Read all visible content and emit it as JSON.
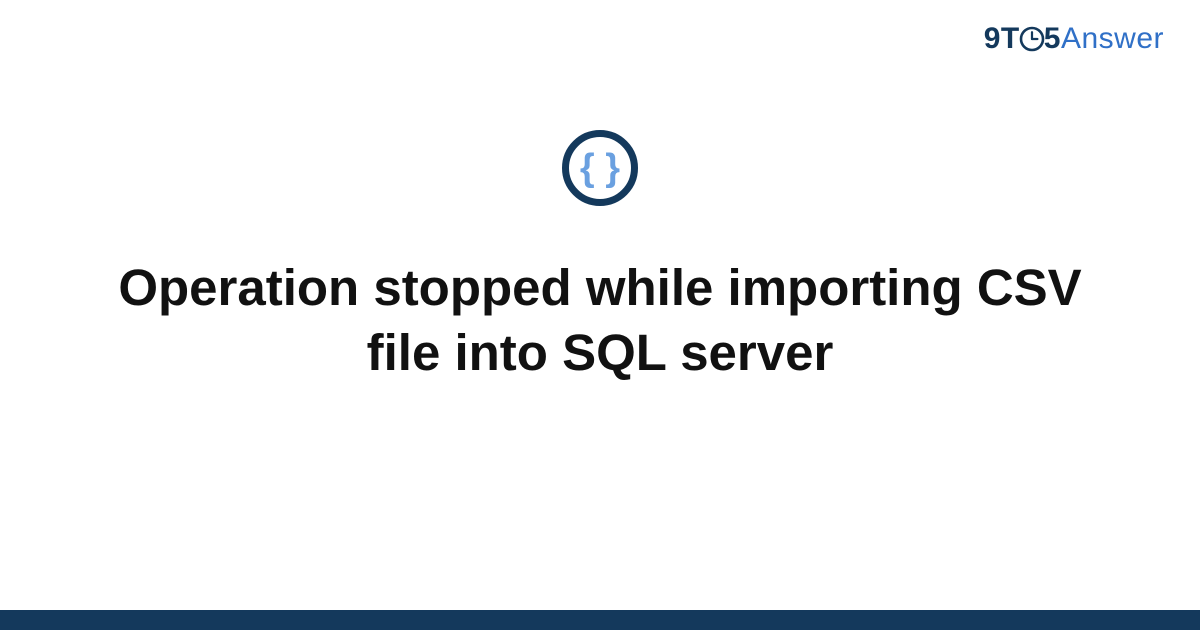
{
  "logo": {
    "prefix": "9T",
    "mid": "5",
    "suffix": "Answer"
  },
  "icon": {
    "name": "code-braces-icon"
  },
  "title": "Operation stopped while importing CSV file into SQL server",
  "colors": {
    "dark_navy": "#14395c",
    "accent_blue": "#3070c7",
    "brace_blue": "#6aa0e0"
  }
}
